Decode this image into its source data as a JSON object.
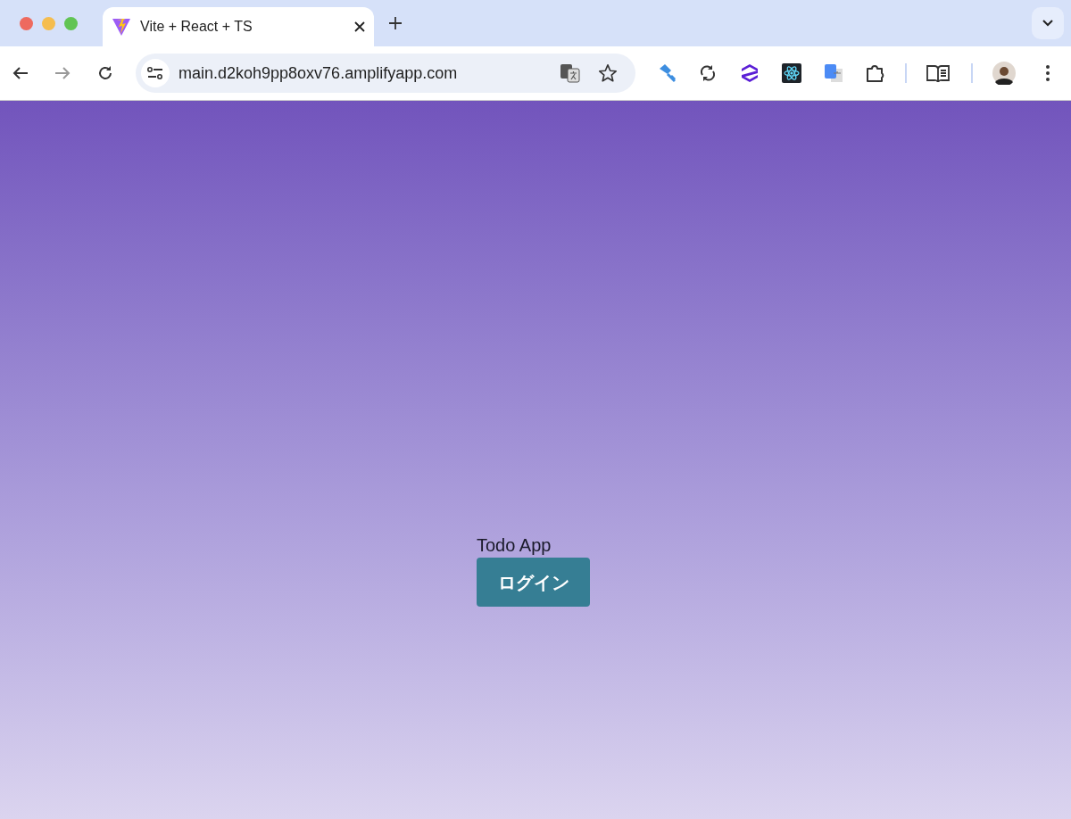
{
  "tabs": [
    {
      "title": "Vite + React + TS",
      "selected": true
    }
  ],
  "address_bar": {
    "url": "main.d2koh9pp8oxv76.amplifyapp.com"
  },
  "page": {
    "title": "Todo App",
    "login_button": "ログイン"
  }
}
